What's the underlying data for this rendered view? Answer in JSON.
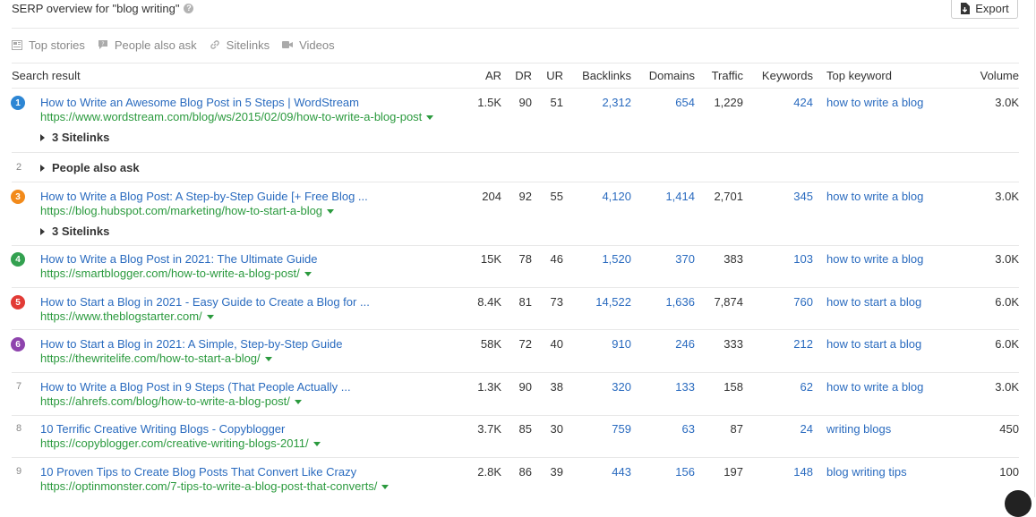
{
  "header": {
    "title": "SERP overview for \"blog writing\"",
    "help_glyph": "?",
    "export_label": "Export"
  },
  "filters": [
    {
      "label": "Top stories",
      "icon": "newspaper-icon"
    },
    {
      "label": "People also ask",
      "icon": "question-bubble-icon"
    },
    {
      "label": "Sitelinks",
      "icon": "link-icon"
    },
    {
      "label": "Videos",
      "icon": "video-camera-icon"
    }
  ],
  "columns": {
    "search_result": "Search result",
    "ar": "AR",
    "dr": "DR",
    "ur": "UR",
    "backlinks": "Backlinks",
    "domains": "Domains",
    "traffic": "Traffic",
    "keywords": "Keywords",
    "top_keyword": "Top keyword",
    "volume": "Volume"
  },
  "badge_colors": {
    "blue": "#2d86d4",
    "orange": "#f28a1a",
    "green": "#33a150",
    "red": "#e23b36",
    "purple": "#8e44ad"
  },
  "results": [
    {
      "pos": "1",
      "color": "#2d86d4",
      "title": "How to Write an Awesome Blog Post in 5 Steps | WordStream",
      "url": "https://www.wordstream.com/blog/ws/2015/02/09/how-to-write-a-blog-post",
      "ar": "1.5K",
      "dr": "90",
      "ur": "51",
      "backlinks": "2,312",
      "domains": "654",
      "traffic": "1,229",
      "keywords": "424",
      "top_keyword": "how to write a blog",
      "volume": "3.0K",
      "sitelinks": "3 Sitelinks"
    },
    {
      "pos": "2",
      "people_also_ask": "People also ask"
    },
    {
      "pos": "3",
      "color": "#f28a1a",
      "title": "How to Write a Blog Post: A Step-by-Step Guide [+ Free Blog ...",
      "url": "https://blog.hubspot.com/marketing/how-to-start-a-blog",
      "ar": "204",
      "dr": "92",
      "ur": "55",
      "backlinks": "4,120",
      "domains": "1,414",
      "traffic": "2,701",
      "keywords": "345",
      "top_keyword": "how to write a blog",
      "volume": "3.0K",
      "sitelinks": "3 Sitelinks"
    },
    {
      "pos": "4",
      "color": "#33a150",
      "title": "How to Write a Blog Post in 2021: The Ultimate Guide",
      "url": "https://smartblogger.com/how-to-write-a-blog-post/",
      "ar": "15K",
      "dr": "78",
      "ur": "46",
      "backlinks": "1,520",
      "domains": "370",
      "traffic": "383",
      "keywords": "103",
      "top_keyword": "how to write a blog",
      "volume": "3.0K"
    },
    {
      "pos": "5",
      "color": "#e23b36",
      "title": "How to Start a Blog in 2021 - Easy Guide to Create a Blog for ...",
      "url": "https://www.theblogstarter.com/",
      "ar": "8.4K",
      "dr": "81",
      "ur": "73",
      "backlinks": "14,522",
      "domains": "1,636",
      "traffic": "7,874",
      "keywords": "760",
      "top_keyword": "how to start a blog",
      "volume": "6.0K"
    },
    {
      "pos": "6",
      "color": "#8e44ad",
      "title": "How to Start a Blog in 2021: A Simple, Step-by-Step Guide",
      "url": "https://thewritelife.com/how-to-start-a-blog/",
      "ar": "58K",
      "dr": "72",
      "ur": "40",
      "backlinks": "910",
      "domains": "246",
      "traffic": "333",
      "keywords": "212",
      "top_keyword": "how to start a blog",
      "volume": "6.0K"
    },
    {
      "pos": "7",
      "title": "How to Write a Blog Post in 9 Steps (That People Actually ...",
      "url": "https://ahrefs.com/blog/how-to-write-a-blog-post/",
      "ar": "1.3K",
      "dr": "90",
      "ur": "38",
      "backlinks": "320",
      "domains": "133",
      "traffic": "158",
      "keywords": "62",
      "top_keyword": "how to write a blog",
      "volume": "3.0K"
    },
    {
      "pos": "8",
      "title": "10 Terrific Creative Writing Blogs - Copyblogger",
      "url": "https://copyblogger.com/creative-writing-blogs-2011/",
      "ar": "3.7K",
      "dr": "85",
      "ur": "30",
      "backlinks": "759",
      "domains": "63",
      "traffic": "87",
      "keywords": "24",
      "top_keyword": "writing blogs",
      "volume": "450"
    },
    {
      "pos": "9",
      "title": "10 Proven Tips to Create Blog Posts That Convert Like Crazy",
      "url": "https://optinmonster.com/7-tips-to-write-a-blog-post-that-converts/",
      "ar": "2.8K",
      "dr": "86",
      "ur": "39",
      "backlinks": "443",
      "domains": "156",
      "traffic": "197",
      "keywords": "148",
      "top_keyword": "blog writing tips",
      "volume": "100"
    }
  ]
}
